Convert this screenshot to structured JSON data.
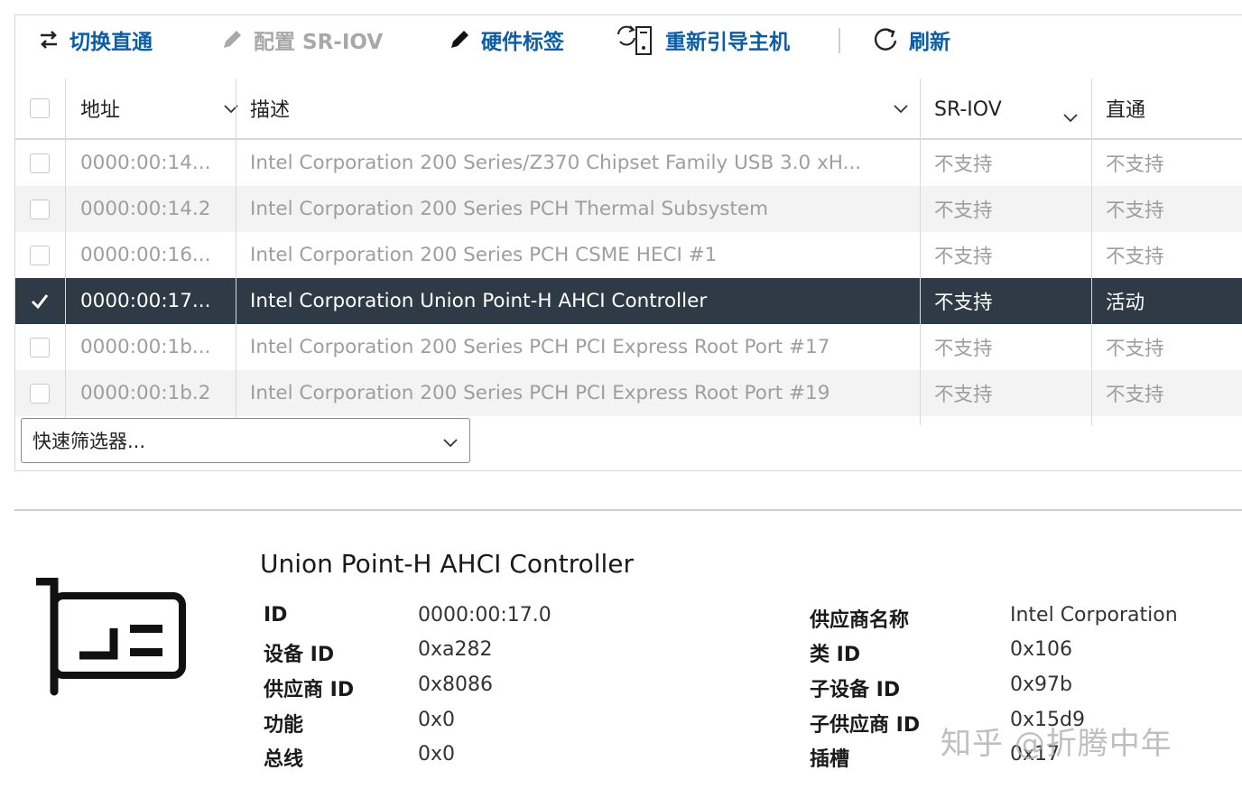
{
  "toolbar": {
    "toggle_passthrough": "切换直通",
    "configure_sriov": "配置 SR-IOV",
    "hardware_label": "硬件标签",
    "reboot_host": "重新引导主机",
    "refresh": "刷新"
  },
  "table": {
    "columns": [
      "地址",
      "描述",
      "SR-IOV",
      "直通"
    ],
    "rows": [
      {
        "address": "0000:00:14...",
        "description": "Intel Corporation 200 Series/Z370 Chipset Family USB 3.0 xH...",
        "sriov": "不支持",
        "passthrough": "不支持",
        "checked": false
      },
      {
        "address": "0000:00:14.2",
        "description": "Intel Corporation 200 Series PCH Thermal Subsystem",
        "sriov": "不支持",
        "passthrough": "不支持",
        "checked": false
      },
      {
        "address": "0000:00:16...",
        "description": "Intel Corporation 200 Series PCH CSME HECI #1",
        "sriov": "不支持",
        "passthrough": "不支持",
        "checked": false
      },
      {
        "address": "0000:00:17...",
        "description": "Intel Corporation Union Point-H AHCI Controller",
        "sriov": "不支持",
        "passthrough": "活动",
        "checked": true
      },
      {
        "address": "0000:00:1b...",
        "description": "Intel Corporation 200 Series PCH PCI Express Root Port #17",
        "sriov": "不支持",
        "passthrough": "不支持",
        "checked": false
      },
      {
        "address": "0000:00:1b.2",
        "description": "Intel Corporation 200 Series PCH PCI Express Root Port #19",
        "sriov": "不支持",
        "passthrough": "不支持",
        "checked": false
      }
    ]
  },
  "filter": {
    "placeholder": "快速筛选器..."
  },
  "details": {
    "title": "Union Point-H AHCI Controller",
    "left": [
      {
        "label": "ID",
        "value": "0000:00:17.0"
      },
      {
        "label": "设备 ID",
        "value": "0xa282"
      },
      {
        "label": "供应商 ID",
        "value": "0x8086"
      },
      {
        "label": "功能",
        "value": "0x0"
      },
      {
        "label": "总线",
        "value": "0x0"
      }
    ],
    "right": [
      {
        "label": "供应商名称",
        "value": "Intel Corporation"
      },
      {
        "label": "类 ID",
        "value": "0x106"
      },
      {
        "label": "子设备 ID",
        "value": "0x97b"
      },
      {
        "label": "子供应商 ID",
        "value": "0x15d9"
      },
      {
        "label": "插槽",
        "value": "0x17"
      }
    ]
  },
  "watermark": "知乎 @折腾中年",
  "colors": {
    "accent": "#0a5ea8",
    "selected_row": "#2e3a45",
    "disabled": "#a8a8a8"
  }
}
